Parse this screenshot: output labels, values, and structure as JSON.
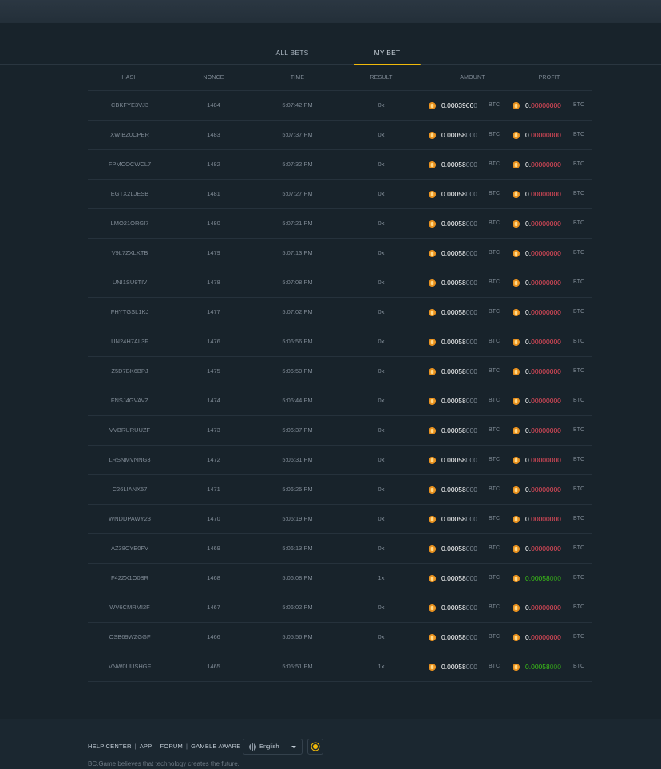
{
  "tabs": [
    {
      "label": "ALL BETS"
    },
    {
      "label": "MY BET"
    }
  ],
  "columns": {
    "hash": "HASH",
    "nonce": "NONCE",
    "time": "TIME",
    "result": "RESULT",
    "amount": "AMOUNT",
    "profit": "PROFIT"
  },
  "currency": "BTC",
  "rows": [
    {
      "hash": "CBKFYE3VJ3",
      "nonce": "1484",
      "time": "5:07:42 PM",
      "result": "0x",
      "amount_bright": "0.0003966",
      "amount_dim": "0",
      "profit_first": "0.",
      "profit_rest": "00000000",
      "win": false
    },
    {
      "hash": "XWIBZ0CPER",
      "nonce": "1483",
      "time": "5:07:37 PM",
      "result": "0x",
      "amount_bright": "0.00058",
      "amount_dim": "000",
      "profit_first": "0.",
      "profit_rest": "00000000",
      "win": false
    },
    {
      "hash": "FPMCOCWCL7",
      "nonce": "1482",
      "time": "5:07:32 PM",
      "result": "0x",
      "amount_bright": "0.00058",
      "amount_dim": "000",
      "profit_first": "0.",
      "profit_rest": "00000000",
      "win": false
    },
    {
      "hash": "EGTX2LJESB",
      "nonce": "1481",
      "time": "5:07:27 PM",
      "result": "0x",
      "amount_bright": "0.00058",
      "amount_dim": "000",
      "profit_first": "0.",
      "profit_rest": "00000000",
      "win": false
    },
    {
      "hash": "LMO21ORGI7",
      "nonce": "1480",
      "time": "5:07:21 PM",
      "result": "0x",
      "amount_bright": "0.00058",
      "amount_dim": "000",
      "profit_first": "0.",
      "profit_rest": "00000000",
      "win": false
    },
    {
      "hash": "V9L7ZXLKTB",
      "nonce": "1479",
      "time": "5:07:13 PM",
      "result": "0x",
      "amount_bright": "0.00058",
      "amount_dim": "000",
      "profit_first": "0.",
      "profit_rest": "00000000",
      "win": false
    },
    {
      "hash": "UNI1SU9TIV",
      "nonce": "1478",
      "time": "5:07:08 PM",
      "result": "0x",
      "amount_bright": "0.00058",
      "amount_dim": "000",
      "profit_first": "0.",
      "profit_rest": "00000000",
      "win": false
    },
    {
      "hash": "FHYTGSL1KJ",
      "nonce": "1477",
      "time": "5:07:02 PM",
      "result": "0x",
      "amount_bright": "0.00058",
      "amount_dim": "000",
      "profit_first": "0.",
      "profit_rest": "00000000",
      "win": false
    },
    {
      "hash": "UN24H7AL3F",
      "nonce": "1476",
      "time": "5:06:56 PM",
      "result": "0x",
      "amount_bright": "0.00058",
      "amount_dim": "000",
      "profit_first": "0.",
      "profit_rest": "00000000",
      "win": false
    },
    {
      "hash": "Z5D7BK6BPJ",
      "nonce": "1475",
      "time": "5:06:50 PM",
      "result": "0x",
      "amount_bright": "0.00058",
      "amount_dim": "000",
      "profit_first": "0.",
      "profit_rest": "00000000",
      "win": false
    },
    {
      "hash": "FNSJ4GVAVZ",
      "nonce": "1474",
      "time": "5:06:44 PM",
      "result": "0x",
      "amount_bright": "0.00058",
      "amount_dim": "000",
      "profit_first": "0.",
      "profit_rest": "00000000",
      "win": false
    },
    {
      "hash": "VVBRURUUZF",
      "nonce": "1473",
      "time": "5:06:37 PM",
      "result": "0x",
      "amount_bright": "0.00058",
      "amount_dim": "000",
      "profit_first": "0.",
      "profit_rest": "00000000",
      "win": false
    },
    {
      "hash": "LRSNMVNNG3",
      "nonce": "1472",
      "time": "5:06:31 PM",
      "result": "0x",
      "amount_bright": "0.00058",
      "amount_dim": "000",
      "profit_first": "0.",
      "profit_rest": "00000000",
      "win": false
    },
    {
      "hash": "C26LIANX57",
      "nonce": "1471",
      "time": "5:06:25 PM",
      "result": "0x",
      "amount_bright": "0.00058",
      "amount_dim": "000",
      "profit_first": "0.",
      "profit_rest": "00000000",
      "win": false
    },
    {
      "hash": "WNDDPAWY23",
      "nonce": "1470",
      "time": "5:06:19 PM",
      "result": "0x",
      "amount_bright": "0.00058",
      "amount_dim": "000",
      "profit_first": "0.",
      "profit_rest": "00000000",
      "win": false
    },
    {
      "hash": "AZ38CYE0FV",
      "nonce": "1469",
      "time": "5:06:13 PM",
      "result": "0x",
      "amount_bright": "0.00058",
      "amount_dim": "000",
      "profit_first": "0.",
      "profit_rest": "00000000",
      "win": false
    },
    {
      "hash": "F42ZX1O0BR",
      "nonce": "1468",
      "time": "5:06:08 PM",
      "result": "1x",
      "amount_bright": "0.00058",
      "amount_dim": "000",
      "profit_first": "0.00058",
      "profit_rest": "000",
      "win": true
    },
    {
      "hash": "WV6CMRMI2F",
      "nonce": "1467",
      "time": "5:06:02 PM",
      "result": "0x",
      "amount_bright": "0.00058",
      "amount_dim": "000",
      "profit_first": "0.",
      "profit_rest": "00000000",
      "win": false
    },
    {
      "hash": "OSB69WZGGF",
      "nonce": "1466",
      "time": "5:05:56 PM",
      "result": "0x",
      "amount_bright": "0.00058",
      "amount_dim": "000",
      "profit_first": "0.",
      "profit_rest": "00000000",
      "win": false
    },
    {
      "hash": "VNW0UUSHGF",
      "nonce": "1465",
      "time": "5:05:51 PM",
      "result": "1x",
      "amount_bright": "0.00058",
      "amount_dim": "000",
      "profit_first": "0.00058",
      "profit_rest": "000",
      "win": true
    }
  ],
  "footer": {
    "links": [
      "HELP CENTER",
      "APP",
      "FORUM",
      "GAMBLE AWARE"
    ],
    "separator": "|",
    "language": "English",
    "tagline": "BC.Game believes that technology creates the future."
  },
  "icons": {
    "coin": "bitcoin-coin-icon",
    "globe": "globe-icon",
    "caret": "chevron-down-icon",
    "theme": "sun-icon"
  },
  "colors": {
    "accent": "#f0b90b",
    "loss": "#ed4c5c",
    "win": "#3bc117",
    "background": "#18232b"
  }
}
